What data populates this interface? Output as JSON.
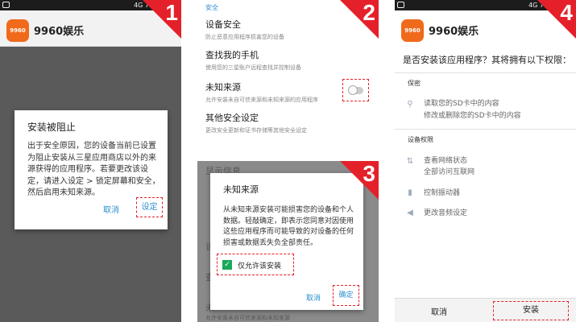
{
  "panel1": {
    "step": "1",
    "status_time": "4G 7",
    "app_name": "9960娱乐",
    "app_icon_text": "9960",
    "dialog_title": "安装被阻止",
    "dialog_body": "出于安全原因，您的设备当前已设置为阻止安装从三星应用商店以外的来源获得的应用程序。若要更改该设定，请进入设定 > 锁定屏幕和安全，然后启用未知来源。",
    "cancel": "取消",
    "settings_btn": "设定"
  },
  "panel2": {
    "step": "2",
    "section": "安全",
    "items": [
      {
        "title": "设备安全",
        "sub": "防止恶意应用程序损害您的设备"
      },
      {
        "title": "查找我的手机",
        "sub": "使用您的三星账户远程查找并控制设备"
      },
      {
        "title": "未知来源",
        "sub": "允许安装未自可信来源和未知来源的应用程序"
      },
      {
        "title": "其他安全设定",
        "sub": "更改安全更新和证书存储等其他安全设定"
      }
    ]
  },
  "panel3": {
    "step": "3",
    "bg_title": "显示信息",
    "dialog_title": "未知来源",
    "dialog_body": "从未知来源安装可能损害您的设备和个人数据。轻敲确定，即表示您同意对因使用这些应用程序而可能导致的对设备的任何损害或数据丢失负全部责任。",
    "checkbox_label": "仅允许该安装",
    "cancel": "取消",
    "ok": "确定",
    "bg_items": [
      "设",
      "查",
      "未"
    ],
    "bg_sub": "允许安装未自可信来源和未知来源"
  },
  "panel4": {
    "step": "4",
    "app_name": "9960娱乐",
    "app_icon_text": "9960",
    "question": "是否安装该应用程序？其将拥有以下权限：",
    "privacy_head": "保密",
    "privacy_items": [
      "读取您的SD卡中的内容",
      "修改或删除您的SD卡中的内容"
    ],
    "device_head": "设备权限",
    "net_items": [
      "查看网络状态",
      "全部访问互联网"
    ],
    "vibrate": "控制振动器",
    "audio": "更改音频设定",
    "cancel": "取消",
    "install": "安装"
  },
  "colors": {
    "accent": "#e4212a",
    "link": "#2a8fcf",
    "toggle_check": "#1aa85a"
  }
}
